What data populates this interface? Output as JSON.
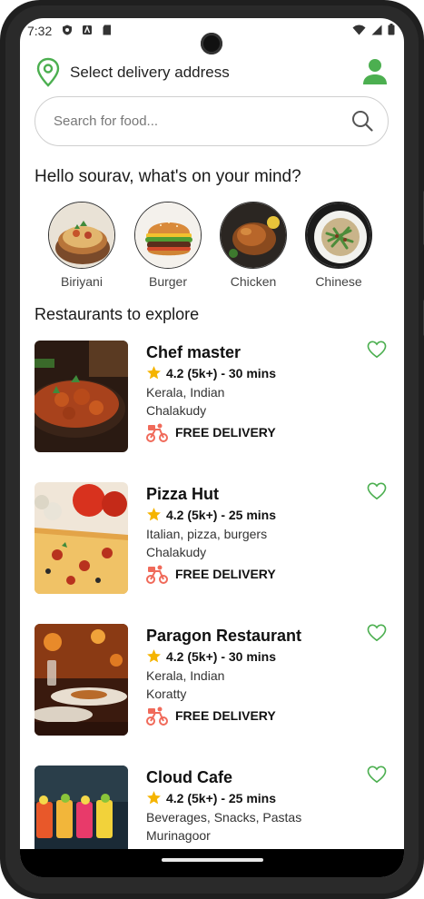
{
  "status_bar": {
    "time": "7:32"
  },
  "header": {
    "title": "Select delivery address"
  },
  "search": {
    "placeholder": "Search for food..."
  },
  "greeting": "Hello sourav, what's on your mind?",
  "categories": [
    {
      "label": "Biriyani"
    },
    {
      "label": "Burger"
    },
    {
      "label": "Chicken"
    },
    {
      "label": "Chinese"
    }
  ],
  "section_title": "Restaurants to explore",
  "restaurants": [
    {
      "name": "Chef master",
      "rating": "4.2 (5k+) - 30 mins",
      "cuisine": "Kerala, Indian",
      "area": "Chalakudy",
      "delivery": "FREE DELIVERY"
    },
    {
      "name": "Pizza Hut",
      "rating": "4.2 (5k+) - 25 mins",
      "cuisine": "Italian, pizza, burgers",
      "area": "Chalakudy",
      "delivery": "FREE DELIVERY"
    },
    {
      "name": "Paragon Restaurant",
      "rating": "4.2 (5k+) - 30 mins",
      "cuisine": "Kerala, Indian",
      "area": "Koratty",
      "delivery": "FREE DELIVERY"
    },
    {
      "name": "Cloud Cafe",
      "rating": "4.2 (5k+) - 25 mins",
      "cuisine": "Beverages, Snacks, Pastas",
      "area": "Murinagoor",
      "delivery": ""
    }
  ],
  "colors": {
    "accent_green": "#4caf50",
    "star": "#f5b400",
    "delivery_red": "#f06a5a"
  }
}
